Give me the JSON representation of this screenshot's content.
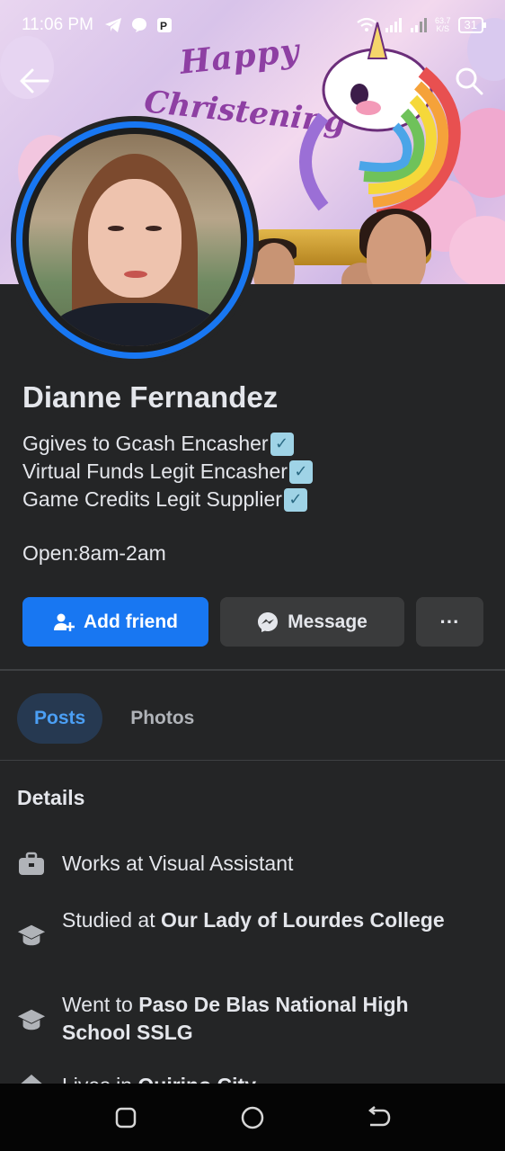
{
  "status_bar": {
    "time": "11:06 PM",
    "speed_value": "63.7",
    "speed_unit": "K/S",
    "battery": "31"
  },
  "cover": {
    "text_line1": "Happy",
    "text_line2": "Christening"
  },
  "profile": {
    "name": "Dianne Fernandez",
    "bio_lines": [
      "Ggives to Gcash Encasher",
      "Virtual Funds Legit Encasher",
      "Game Credits Legit Supplier"
    ],
    "hours": "Open:8am-2am"
  },
  "actions": {
    "add_friend": "Add friend",
    "message": "Message",
    "more": "···"
  },
  "tabs": [
    {
      "label": "Posts",
      "active": true
    },
    {
      "label": "Photos",
      "active": false
    }
  ],
  "details": {
    "title": "Details",
    "items": [
      {
        "icon": "briefcase-icon",
        "prefix": "Works at ",
        "bold": "Visual Assistant",
        "bold_is_plain": true
      },
      {
        "icon": "graduation-cap-icon",
        "prefix": "Studied at ",
        "bold": "Our Lady of Lourdes College"
      },
      {
        "icon": "graduation-cap-icon",
        "prefix": "Went to ",
        "bold": "Paso De Blas National High School SSLG"
      },
      {
        "icon": "home-icon",
        "prefix": "Lives in ",
        "bold": "Quirino City"
      }
    ]
  },
  "colors": {
    "background": "#242526",
    "primary": "#1877f2",
    "secondary_button": "#3a3b3c",
    "active_tab_bg": "#263951",
    "active_tab_text": "#4b9ff5"
  }
}
